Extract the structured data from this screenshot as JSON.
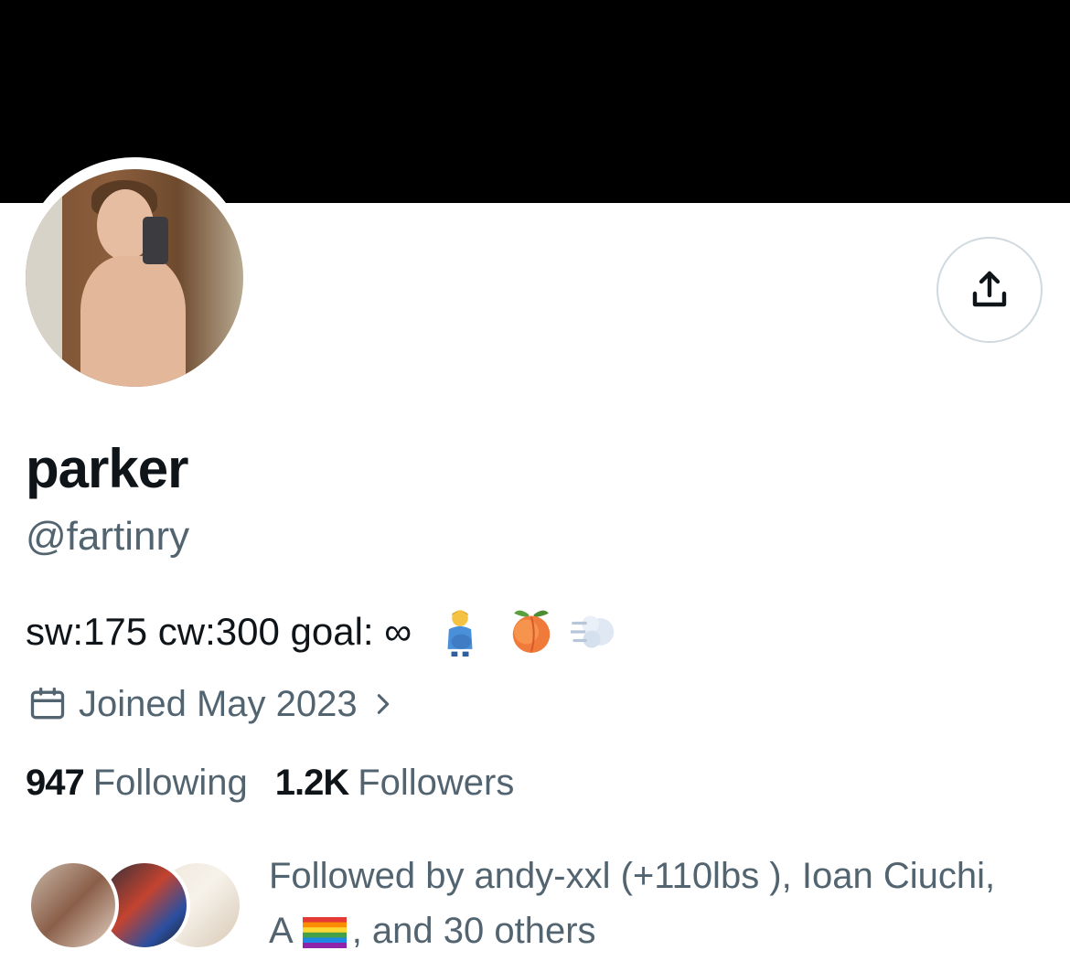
{
  "profile": {
    "display_name": "parker",
    "handle": "@fartinry",
    "bio_text": "sw:175 cw:300 goal: ∞",
    "bio_emojis": [
      "pregnant-man-emoji",
      "peach-emoji",
      "dash-emoji"
    ],
    "joined": "Joined May 2023"
  },
  "stats": {
    "following_count": "947",
    "following_label": "Following",
    "followers_count": "1.2K",
    "followers_label": "Followers"
  },
  "followed_by": {
    "line1": "Followed by andy-xxl (+110lbs ), Ioan Ciuchi,",
    "line2_prefix": "A",
    "line2_suffix": ", and 30 others"
  },
  "icons": {
    "share": "share-icon",
    "calendar": "calendar-icon",
    "chevron": "chevron-right-icon",
    "flag": "rainbow-flag-icon"
  },
  "colors": {
    "banner": "#000000",
    "text_primary": "#0f1419",
    "text_secondary": "#536471",
    "border": "#cfd9de"
  }
}
